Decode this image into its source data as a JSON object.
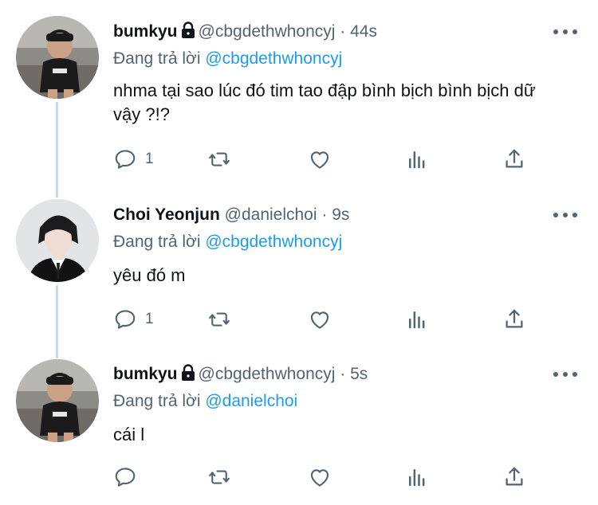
{
  "tweets": [
    {
      "display_name": "bumkyu",
      "handle": "@cbgdethwhoncyj",
      "separator": "·",
      "time": "44s",
      "replying_prefix": "Đang trả lời",
      "replying_to": "@cbgdethwhoncyj",
      "text": "nhma tại sao lúc đó tim tao đập bình bịch bình bịch dữ vậy ?!?",
      "reply_count": "1"
    },
    {
      "display_name": "Choi Yeonjun",
      "handle": "@danielchoi",
      "separator": "·",
      "time": "9s",
      "replying_prefix": "Đang trả lời",
      "replying_to": "@cbgdethwhoncyj",
      "text": "yêu đó m",
      "reply_count": "1"
    },
    {
      "display_name": "bumkyu",
      "handle": "@cbgdethwhoncyj",
      "separator": "·",
      "time": "5s",
      "replying_prefix": "Đang trả lời",
      "replying_to": "@danielchoi",
      "text": "cái l",
      "reply_count": ""
    }
  ],
  "icons": {
    "reply": "speech-bubble-icon",
    "retweet": "retweet-icon",
    "like": "heart-icon",
    "analytics": "bar-chart-icon",
    "share": "share-upload-icon",
    "more": "more-dots-icon",
    "lock": "lock-icon"
  },
  "colors": {
    "text": "#0f1419",
    "secondary": "#536471",
    "accent": "#1d9bf0",
    "thread_line": "#cfd9de"
  }
}
